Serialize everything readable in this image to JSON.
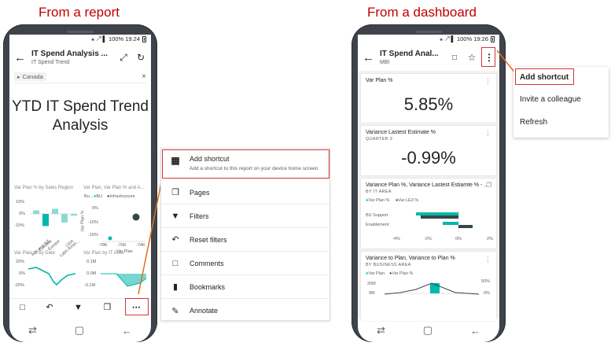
{
  "captions": {
    "left": "From a report",
    "right": "From a dashboard"
  },
  "status": {
    "left": "⚹ ↗ ▌ 100%  19:24",
    "right": "⚹ ↗ ▌ 100%  19:26"
  },
  "report_phone": {
    "title": "IT Spend Analysis ...",
    "subtitle": "IT Spend Trend",
    "filter_chip": "Canada",
    "report_title_line1": "YTD IT Spend Trend",
    "report_title_line2": "Analysis",
    "chart1": {
      "title": "Var Plan % by Sales Region",
      "y_ticks": [
        "10%",
        "0%",
        "-10%"
      ],
      "categories": [
        "Aus and NZ",
        "Canada",
        "Europe",
        "Latin Amer...",
        "USA"
      ],
      "values": [
        2,
        -7,
        3,
        -5,
        -1
      ]
    },
    "chart2": {
      "title": "Var Plan, Var Plan % and A...",
      "legend_prefix": "Bu...",
      "legend": [
        "BU",
        "Infrastructure"
      ],
      "y_label": "Var Plan %",
      "y_ticks": [
        "0%",
        "-10%",
        "-15%"
      ],
      "x_ticks": [
        "-78K",
        "-76K",
        "-74K"
      ],
      "x_label": "Var Plan"
    },
    "chart3": {
      "title": "Var Plan % by Date",
      "y_ticks": [
        "20%",
        "0%",
        "-20%"
      ]
    },
    "chart4": {
      "title": "Var Plan by IT Area",
      "y_ticks": [
        "0.1M",
        "0.0M",
        "-0.1M"
      ]
    },
    "colors": {
      "teal": "#01b8aa",
      "dark": "#374649"
    }
  },
  "menu": {
    "items": [
      {
        "icon": "bar-chart-icon",
        "label": "Add shortcut",
        "desc": "Add a shortcut to this report on your device home screen"
      },
      {
        "icon": "pages-icon",
        "label": "Pages"
      },
      {
        "icon": "filter-icon",
        "label": "Filters"
      },
      {
        "icon": "reset-icon",
        "label": "Reset filters"
      },
      {
        "icon": "comments-icon",
        "label": "Comments"
      },
      {
        "icon": "bookmark-icon",
        "label": "Bookmarks"
      },
      {
        "icon": "annotate-icon",
        "label": "Annotate"
      }
    ]
  },
  "dashboard_phone": {
    "title": "IT Spend Anal...",
    "subtitle": "MBI",
    "tiles": [
      {
        "title": "Var Plan %",
        "value": "5.85%"
      },
      {
        "title": "Variance Lastest Estimate %",
        "subtitle": "QUARTER 3",
        "value": "-0.99%"
      },
      {
        "title": "Variance Plan %, Variance Lastest Estiamte % - ...",
        "subtitle": "BY IT AREA",
        "legend": [
          "Var Plan %",
          "Var LE3 %"
        ],
        "categories": [
          "BU Support",
          "Enablement"
        ],
        "x_ticks": [
          "-4%",
          "-2%",
          "0%",
          "2%"
        ]
      },
      {
        "title": "Variance to Plan, Variance to Plan %",
        "subtitle": "BY BUSINESS AREA",
        "legend": [
          "Var Plan",
          "Var Plan %"
        ],
        "y_left_ticks": [
          "20M",
          "0M"
        ],
        "y_right_ticks": [
          "50%",
          "0%"
        ]
      }
    ]
  },
  "popup_menu": {
    "items": [
      "Add shortcut",
      "Invite a colleague",
      "Refresh"
    ]
  }
}
